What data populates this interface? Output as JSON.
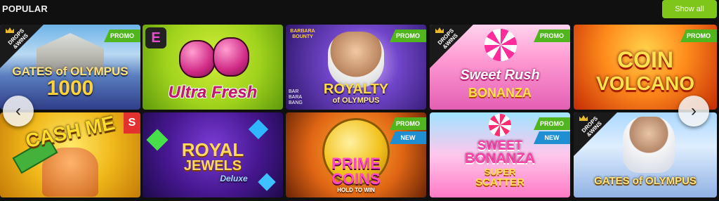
{
  "header": {
    "title": "POPULAR",
    "show_all_label": "Show all"
  },
  "badges": {
    "promo": "PROMO",
    "new": "NEW",
    "drops_wins": "DROPS &WINS"
  },
  "games": [
    {
      "line1": "GATES of OLYMPUS",
      "line2": "1000"
    },
    {
      "line1": "Ultra Fresh",
      "logo": "E"
    },
    {
      "line1": "ROYALTY",
      "line2": "of OLYMPUS",
      "small1": "BAR BARA BANG",
      "small2": "BARBARA BOUNTY"
    },
    {
      "line1": "Sweet Rush",
      "line2": "BONANZA"
    },
    {
      "line1": "COIN",
      "line2": "VOLCANO"
    },
    {
      "line1": "CASH ME",
      "side": "S"
    },
    {
      "line1": "ROYAL",
      "line2": "JEWELS",
      "line3": "Deluxe"
    },
    {
      "line1": "PRIME",
      "line2": "COINS",
      "line3": "HOLD TO WIN"
    },
    {
      "line1": "SWEET",
      "line2": "BONANZA",
      "line3": "SUPER",
      "line4": "SCATTER"
    },
    {
      "line1": "GATES of OLYMPUS"
    }
  ],
  "nav": {
    "prev": "‹",
    "next": "›"
  }
}
